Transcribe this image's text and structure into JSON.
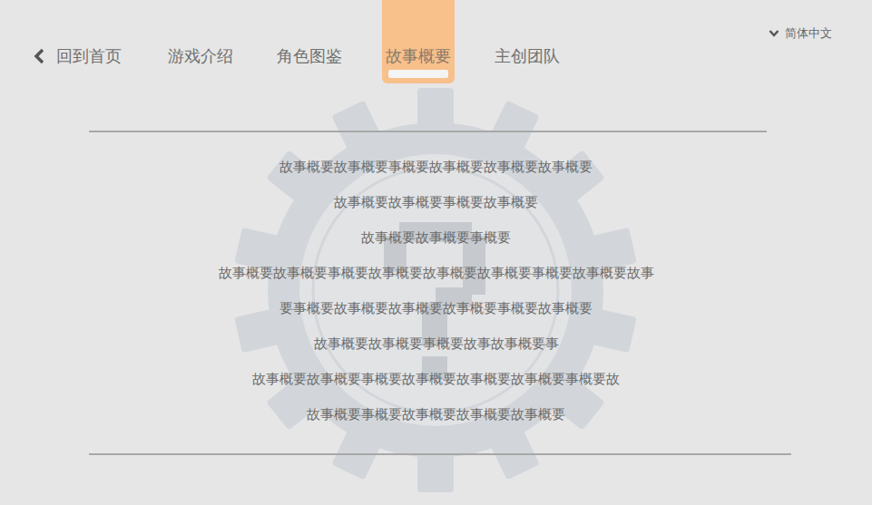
{
  "nav": {
    "back": {
      "label": "回到首页"
    },
    "tabs": [
      {
        "label": "游戏介绍",
        "selected": false
      },
      {
        "label": "角色图鉴",
        "selected": false
      },
      {
        "label": "故事概要",
        "selected": true
      },
      {
        "label": "主创团队",
        "selected": false
      }
    ]
  },
  "language": {
    "label": "简体中文"
  },
  "story": {
    "lines": [
      "故事概要故事概要事概要故事概要故事概要故事概要",
      "故事概要故事概要事概要故事概要",
      "故事概要故事概要事概要",
      "故事概要故事概要事概要故事概要故事概要故事概要事概要故事概要故事",
      "要事概要故事概要故事概要故事概要事概要故事概要",
      "故事概要故事概要事概要故事故事概要事",
      "故事概要故事概要事概要故事概要故事概要故事概要事概要故",
      "故事概要事概要故事概要故事概要故事概要"
    ]
  }
}
